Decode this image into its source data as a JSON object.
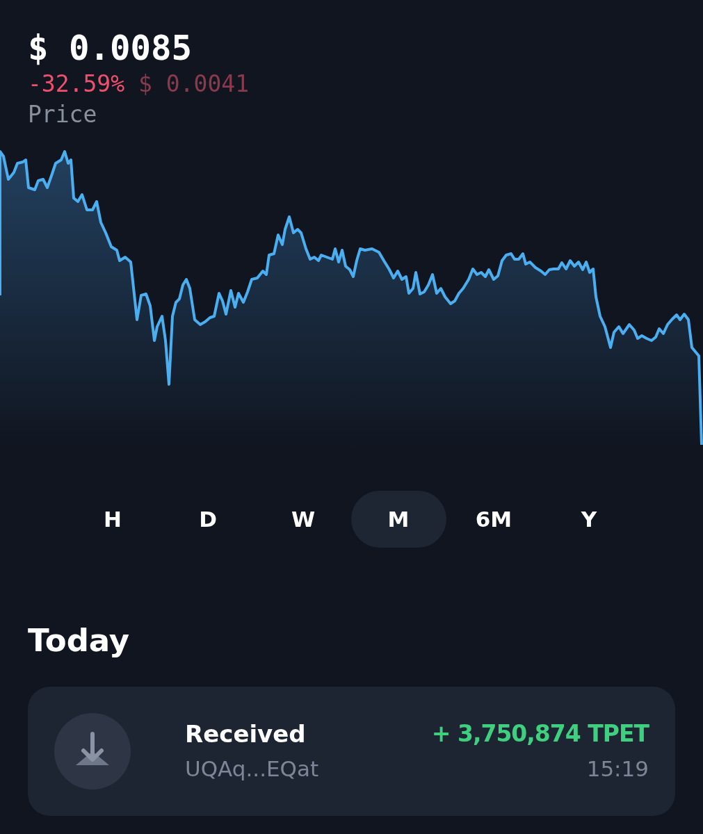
{
  "price": {
    "value": "$ 0.0085",
    "negative": true,
    "change_percent": "-32.59%",
    "change_amount": "$ 0.0041",
    "label": "Price"
  },
  "timeframes": [
    {
      "label": "H",
      "selected": false
    },
    {
      "label": "D",
      "selected": false
    },
    {
      "label": "W",
      "selected": false
    },
    {
      "label": "M",
      "selected": true
    },
    {
      "label": "6M",
      "selected": false
    },
    {
      "label": "Y",
      "selected": false
    }
  ],
  "sections": [
    {
      "title": "Today",
      "transactions": [
        {
          "kind": "received",
          "title": "Received",
          "address": "UQAq...EQat",
          "amount": "+ 3,750,874 TPET",
          "time": "15:19"
        }
      ]
    }
  ]
}
